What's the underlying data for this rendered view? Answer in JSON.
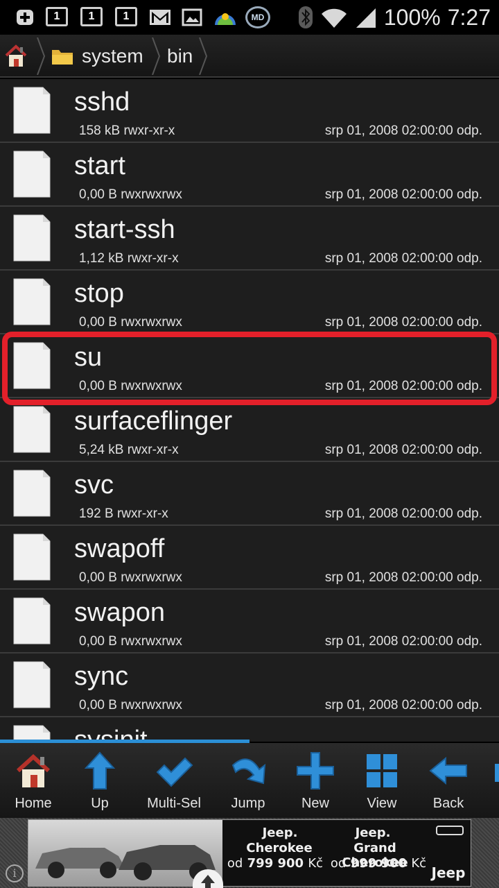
{
  "status_bar": {
    "notification_icons": [
      "plus-icon",
      "calendar-1-icon",
      "calendar-1-icon",
      "calendar-1-icon",
      "gmail-icon",
      "gallery-icon",
      "weather-icon",
      "app-md-icon"
    ],
    "calendar_day": "1",
    "app_badge": "MD",
    "battery": "100%",
    "time": "7:27"
  },
  "path_bar": {
    "crumbs": [
      "system",
      "bin"
    ]
  },
  "files": [
    {
      "name": "sshd",
      "size": "158 kB",
      "perms": "rwxr-xr-x",
      "date": "srp 01, 2008 02:00:00 odp."
    },
    {
      "name": "start",
      "size": "0,00 B",
      "perms": "rwxrwxrwx",
      "date": "srp 01, 2008 02:00:00 odp."
    },
    {
      "name": "start-ssh",
      "size": "1,12 kB",
      "perms": "rwxr-xr-x",
      "date": "srp 01, 2008 02:00:00 odp."
    },
    {
      "name": "stop",
      "size": "0,00 B",
      "perms": "rwxrwxrwx",
      "date": "srp 01, 2008 02:00:00 odp."
    },
    {
      "name": "su",
      "size": "0,00 B",
      "perms": "rwxrwxrwx",
      "date": "srp 01, 2008 02:00:00 odp."
    },
    {
      "name": "surfaceflinger",
      "size": "5,24 kB",
      "perms": "rwxr-xr-x",
      "date": "srp 01, 2008 02:00:00 odp."
    },
    {
      "name": "svc",
      "size": "192 B",
      "perms": "rwxr-xr-x",
      "date": "srp 01, 2008 02:00:00 odp."
    },
    {
      "name": "swapoff",
      "size": "0,00 B",
      "perms": "rwxrwxrwx",
      "date": "srp 01, 2008 02:00:00 odp."
    },
    {
      "name": "swapon",
      "size": "0,00 B",
      "perms": "rwxrwxrwx",
      "date": "srp 01, 2008 02:00:00 odp."
    },
    {
      "name": "sync",
      "size": "0,00 B",
      "perms": "rwxrwxrwx",
      "date": "srp 01, 2008 02:00:00 odp."
    },
    {
      "name": "sysinit",
      "size": "",
      "perms": "",
      "date": ""
    }
  ],
  "highlighted_file": "su",
  "highlight_color": "#e3202a",
  "accent_color": "#2b8fd6",
  "toolbar": {
    "buttons": [
      {
        "label": "Home",
        "icon": "home-icon"
      },
      {
        "label": "Up",
        "icon": "up-arrow-icon"
      },
      {
        "label": "Multi-Sel",
        "icon": "checkmark-icon"
      },
      {
        "label": "Jump",
        "icon": "jump-arrow-icon"
      },
      {
        "label": "New",
        "icon": "plus-icon"
      },
      {
        "label": "View",
        "icon": "grid-icon"
      },
      {
        "label": "Back",
        "icon": "back-arrow-icon"
      }
    ]
  },
  "ad": {
    "left_brand": "Jeep.",
    "left_model": "Cherokee",
    "left_price_prefix": "od",
    "left_price": "799 900",
    "left_currency": "Kč",
    "right_brand": "Jeep.",
    "right_model": "Grand Cherokee",
    "right_price_prefix": "od",
    "right_price": "999 900",
    "right_currency": "Kč",
    "logo": "Jeep",
    "info_icon": "i"
  }
}
